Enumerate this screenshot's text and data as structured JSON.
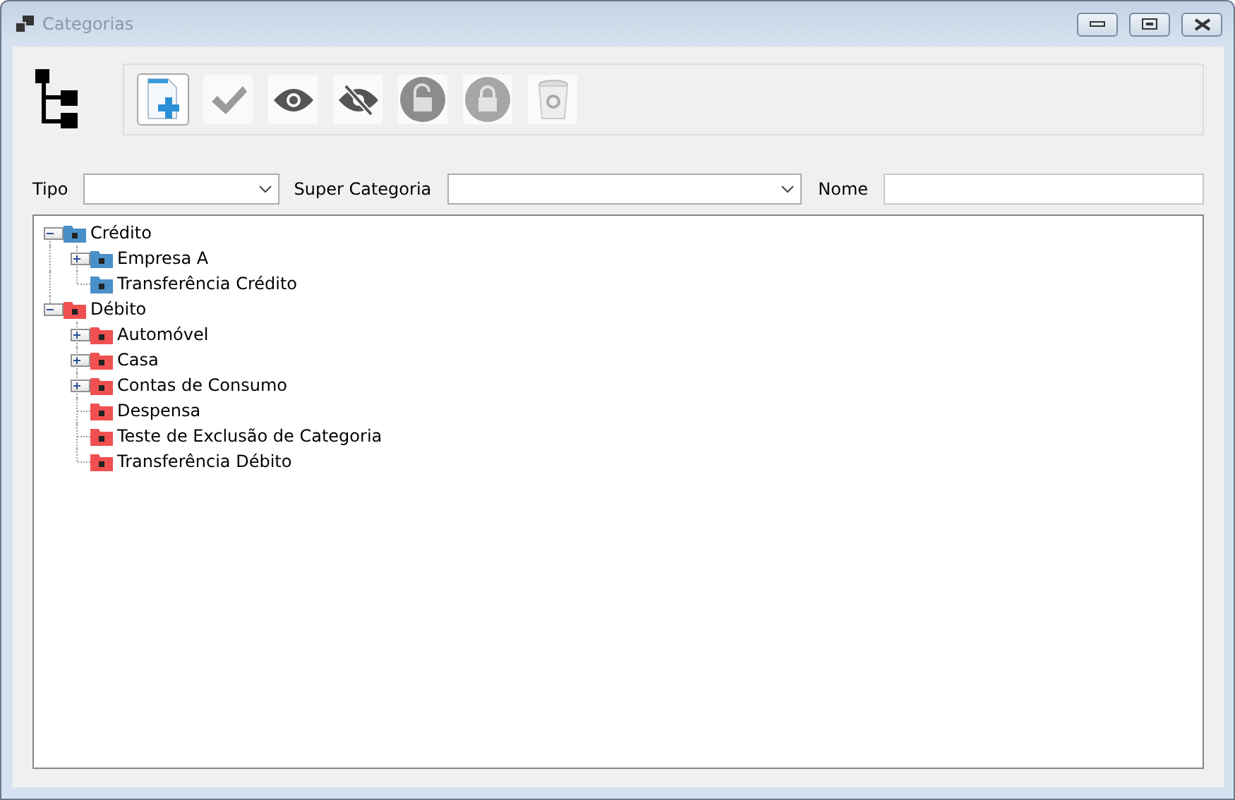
{
  "window": {
    "title": "Categorias"
  },
  "toolbar": [
    {
      "kind": "new",
      "selected": true
    },
    {
      "kind": "check",
      "selected": false
    },
    {
      "kind": "show",
      "selected": false
    },
    {
      "kind": "hide",
      "selected": false
    },
    {
      "kind": "unlock",
      "selected": false
    },
    {
      "kind": "lock",
      "selected": false
    },
    {
      "kind": "trash",
      "selected": false
    }
  ],
  "filters": {
    "tipo_label": "Tipo",
    "super_label": "Super Categoria",
    "nome_label": "Nome"
  },
  "tree": [
    {
      "label": "Crédito",
      "color": "#4a90c8",
      "expanded": true,
      "children": [
        {
          "label": "Empresa A",
          "color": "#4a90c8",
          "expanded": false
        },
        {
          "label": "Transferência Crédito",
          "color": "#4a90c8"
        }
      ]
    },
    {
      "label": "Débito",
      "color": "#f05050",
      "expanded": true,
      "children": [
        {
          "label": "Automóvel",
          "color": "#f05050",
          "expanded": false
        },
        {
          "label": "Casa",
          "color": "#f05050",
          "expanded": false
        },
        {
          "label": "Contas de Consumo",
          "color": "#f05050",
          "expanded": false
        },
        {
          "label": "Despensa",
          "color": "#f05050"
        },
        {
          "label": "Teste de Exclusão de Categoria",
          "color": "#f05050"
        },
        {
          "label": "Transferência Débito",
          "color": "#f05050"
        }
      ]
    }
  ]
}
